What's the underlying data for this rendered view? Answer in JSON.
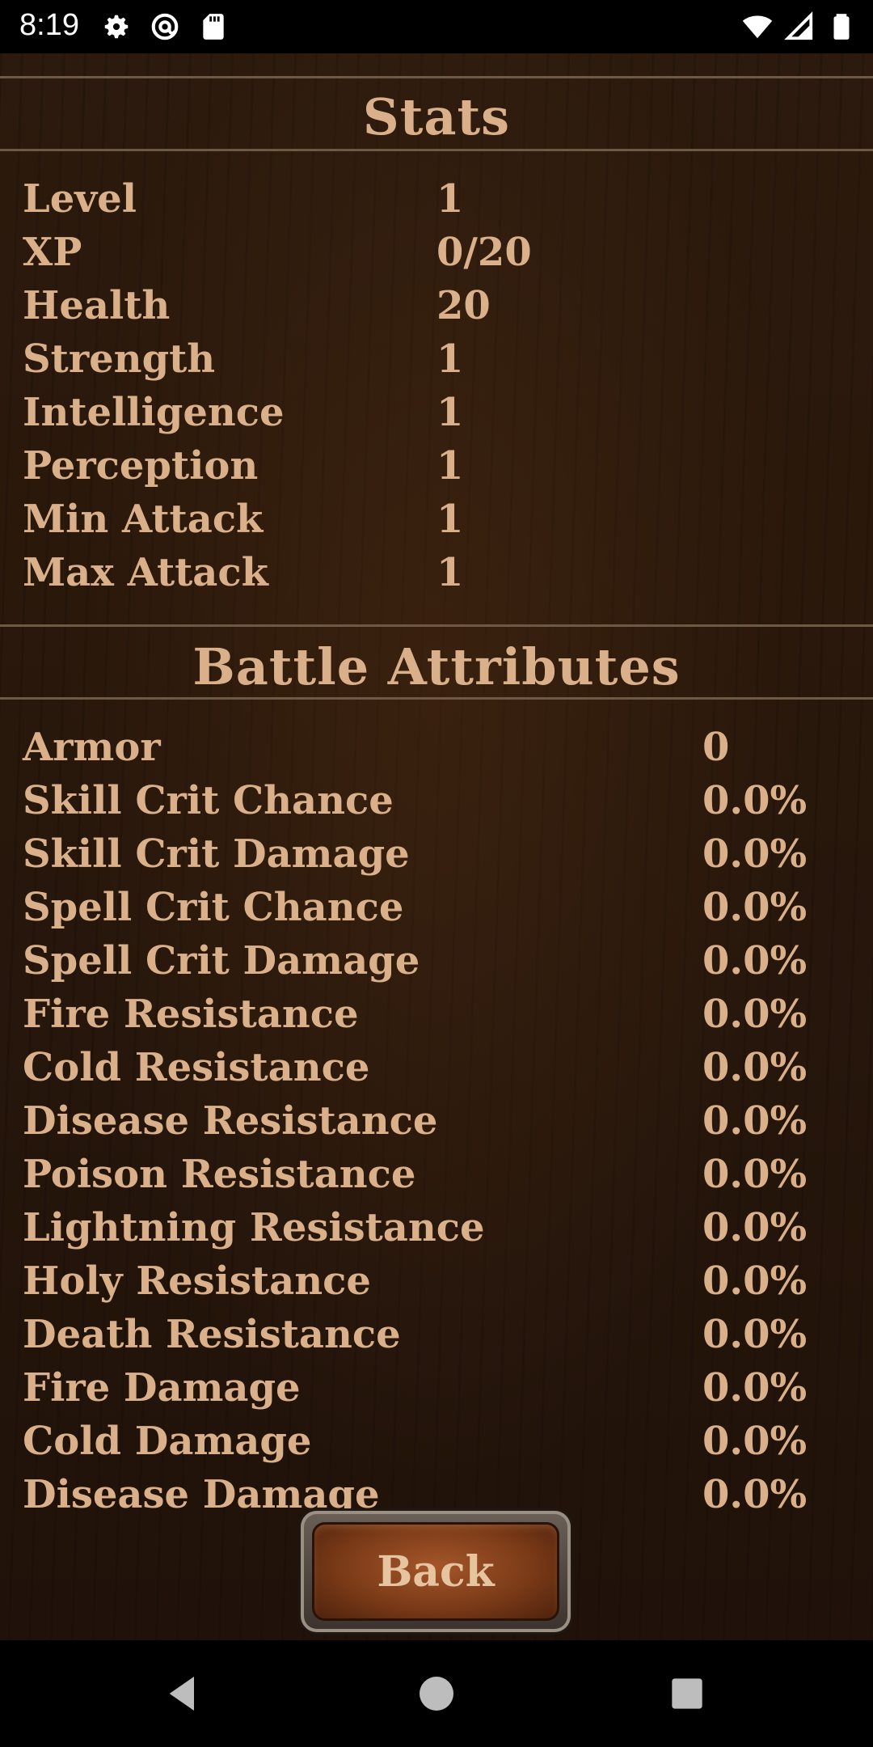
{
  "status_bar": {
    "time": "8:19",
    "icons_left": [
      "gear-icon",
      "at-sign-icon",
      "sd-card-icon"
    ],
    "icons_right": [
      "wifi-icon",
      "signal-icon",
      "battery-icon"
    ]
  },
  "stats": {
    "title": "Stats",
    "rows": [
      {
        "label": "Level",
        "value": "1"
      },
      {
        "label": "XP",
        "value": "0/20"
      },
      {
        "label": "Health",
        "value": "20"
      },
      {
        "label": "Strength",
        "value": "1"
      },
      {
        "label": "Intelligence",
        "value": "1"
      },
      {
        "label": "Perception",
        "value": "1"
      },
      {
        "label": "Min Attack",
        "value": "1"
      },
      {
        "label": "Max Attack",
        "value": "1"
      }
    ]
  },
  "battle": {
    "title": "Battle Attributes",
    "rows": [
      {
        "label": "Armor",
        "value": "0"
      },
      {
        "label": "Skill Crit Chance",
        "value": "0.0%"
      },
      {
        "label": "Skill Crit Damage",
        "value": "0.0%"
      },
      {
        "label": "Spell Crit Chance",
        "value": "0.0%"
      },
      {
        "label": "Spell Crit Damage",
        "value": "0.0%"
      },
      {
        "label": "Fire Resistance",
        "value": "0.0%"
      },
      {
        "label": "Cold Resistance",
        "value": "0.0%"
      },
      {
        "label": "Disease Resistance",
        "value": "0.0%"
      },
      {
        "label": "Poison Resistance",
        "value": "0.0%"
      },
      {
        "label": "Lightning Resistance",
        "value": "0.0%"
      },
      {
        "label": "Holy Resistance",
        "value": "0.0%"
      },
      {
        "label": "Death Resistance",
        "value": "0.0%"
      },
      {
        "label": "Fire Damage",
        "value": "0.0%"
      },
      {
        "label": "Cold Damage",
        "value": "0.0%"
      },
      {
        "label": "Disease Damage",
        "value": "0.0%"
      }
    ]
  },
  "back_button": {
    "label": "Back"
  },
  "nav": [
    "back-triangle-icon",
    "home-circle-icon",
    "recents-square-icon"
  ],
  "colors": {
    "text": "#d9b08a",
    "divider": "#6e5a44",
    "button": "#7a3a17"
  }
}
